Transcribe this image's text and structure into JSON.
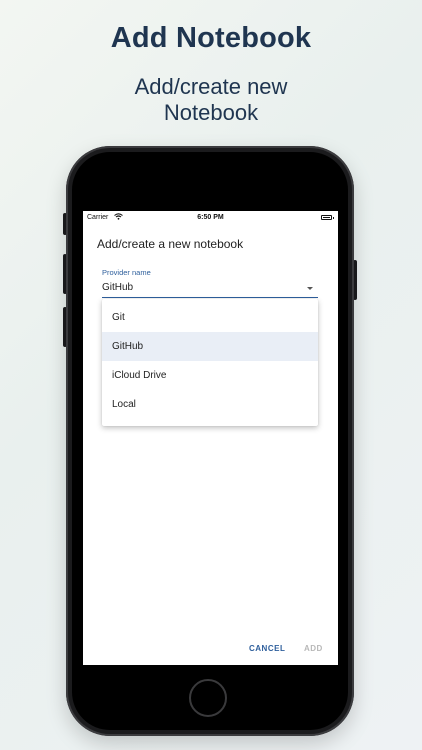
{
  "header": {
    "title": "Add Notebook",
    "subtitle_line1": "Add/create new",
    "subtitle_line2": "Notebook"
  },
  "status_bar": {
    "carrier": "Carrier",
    "time": "6:50 PM"
  },
  "dialog": {
    "title": "Add/create a new notebook",
    "field_label": "Provider name",
    "field_value": "GitHub",
    "options": [
      {
        "label": "Git",
        "selected": false
      },
      {
        "label": "GitHub",
        "selected": true
      },
      {
        "label": "iCloud Drive",
        "selected": false
      },
      {
        "label": "Local",
        "selected": false
      }
    ],
    "cancel_label": "CANCEL",
    "add_label": "ADD"
  },
  "colors": {
    "heading": "#1f3550",
    "accent": "#2e5f9c",
    "selected_bg": "#e9eef6",
    "disabled": "#b8b8b8"
  },
  "icons": [
    "wifi-icon",
    "battery-icon",
    "dropdown-arrow-icon",
    "home-button"
  ]
}
